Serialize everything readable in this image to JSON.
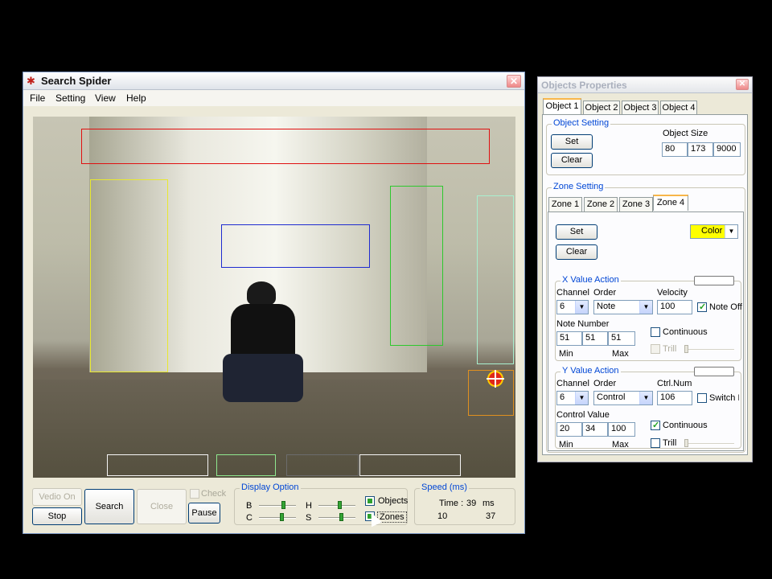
{
  "main_window": {
    "title": "Search Spider",
    "close_glyph": "✕",
    "menu": [
      "File",
      "Setting",
      "View",
      "Help"
    ]
  },
  "controls": {
    "vedio_on": "Vedio On",
    "stop": "Stop",
    "search": "Search",
    "close": "Close",
    "check": "Check",
    "pause": "Pause"
  },
  "display_option": {
    "label": "Display Option",
    "sliders": [
      "B",
      "H",
      "C",
      "S"
    ],
    "objects_label": "Objects",
    "zones_label": "Zones"
  },
  "speed": {
    "label": "Speed (ms)",
    "time_label": "Time :",
    "time_value": "39",
    "time_unit": "ms",
    "left_value": "10",
    "right_value": "37"
  },
  "props_window": {
    "title": "Objects Properties",
    "close_glyph": "✕",
    "object_tabs": [
      "Object 1",
      "Object 2",
      "Object 3",
      "Object 4"
    ],
    "object_setting": {
      "label": "Object Setting",
      "set": "Set",
      "clear": "Clear",
      "size_label": "Object Size",
      "size_values": [
        "80",
        "173",
        "9000"
      ]
    },
    "zone_setting": {
      "label": "Zone Setting",
      "tabs": [
        "Zone 1",
        "Zone 2",
        "Zone 3",
        "Zone 4"
      ],
      "set": "Set",
      "clear": "Clear",
      "color_label": "Color",
      "color_swatch": "#ffff00"
    },
    "x_action": {
      "label": "X Value Action",
      "channel_label": "Channel",
      "channel_value": "6",
      "order_label": "Order",
      "order_value": "Note",
      "velocity_label": "Velocity",
      "velocity_value": "100",
      "noteoff_label": "Note Off",
      "note_number_label": "Note Number",
      "note_values": [
        "51",
        "51",
        "51"
      ],
      "min_label": "Min",
      "max_label": "Max",
      "continuous_label": "Continuous",
      "trill_label": "Trill"
    },
    "y_action": {
      "label": "Y Value Action",
      "channel_label": "Channel",
      "channel_value": "6",
      "order_label": "Order",
      "order_value": "Control",
      "ctrl_label": "Ctrl.Num",
      "ctrl_value": "106",
      "switch_label": "Switch N",
      "control_value_label": "Control Value",
      "control_values": [
        "20",
        "34",
        "100"
      ],
      "min_label": "Min",
      "max_label": "Max",
      "continuous_label": "Continuous",
      "trill_label": "Trill"
    }
  },
  "colors": {
    "zone_red": "#e01010",
    "zone_yellow": "#e8e830",
    "zone_blue": "#1e2bd0",
    "zone_green": "#2ec82e",
    "zone_cyan": "#a8f0d0",
    "zone_orange": "#e09020",
    "floor_zone": "#f5f5f5"
  }
}
